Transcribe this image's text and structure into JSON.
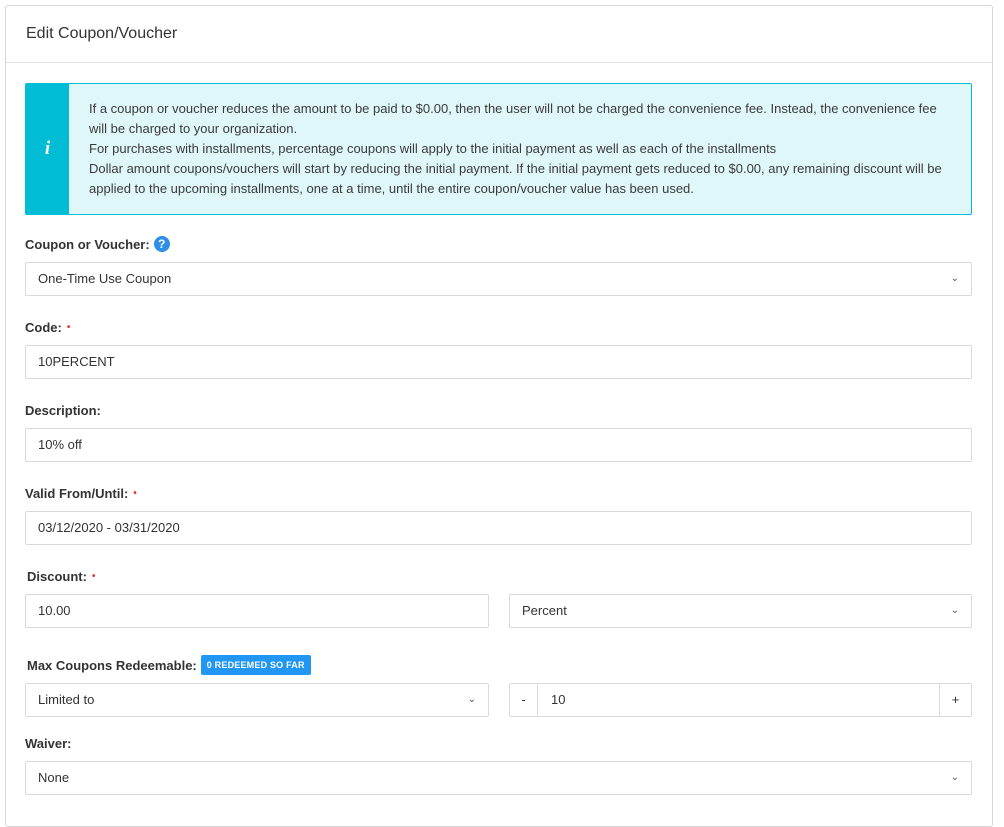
{
  "panel": {
    "title": "Edit Coupon/Voucher"
  },
  "alert": {
    "lines": [
      "If a coupon or voucher reduces the amount to be paid to $0.00, then the user will not be charged the convenience fee. Instead, the convenience fee will be charged to your organization.",
      "For purchases with installments, percentage coupons will apply to the initial payment as well as each of the installments",
      "Dollar amount coupons/vouchers will start by reducing the initial payment. If the initial payment gets reduced to $0.00, any remaining discount will be applied to the upcoming installments, one at a time, until the entire coupon/voucher value has been used."
    ]
  },
  "form": {
    "coupon_type": {
      "label": "Coupon or Voucher:",
      "value": "One-Time Use Coupon"
    },
    "code": {
      "label": "Code:",
      "value": "10PERCENT"
    },
    "description": {
      "label": "Description:",
      "value": "10% off"
    },
    "valid": {
      "label": "Valid From/Until:",
      "value": "03/12/2020 - 03/31/2020"
    },
    "discount": {
      "label": "Discount:",
      "amount": "10.00",
      "type": "Percent"
    },
    "max_redeemable": {
      "label": "Max Coupons Redeemable:",
      "badge": "0 REDEEMED SO FAR",
      "limit_type": "Limited to",
      "minus": "-",
      "count": "10",
      "plus": "+"
    },
    "waiver": {
      "label": "Waiver:",
      "value": "None"
    },
    "required_mark": "•",
    "help_glyph": "?",
    "chevron": "⌄"
  },
  "icons": {
    "info": "info-icon",
    "help": "help-icon",
    "chevron": "chevron-down-icon"
  },
  "colors": {
    "accent": "#00bcd4",
    "alert_bg": "#e0f7fa",
    "badge": "#2196f3",
    "help": "#2e8fe6",
    "required": "#e53935"
  }
}
